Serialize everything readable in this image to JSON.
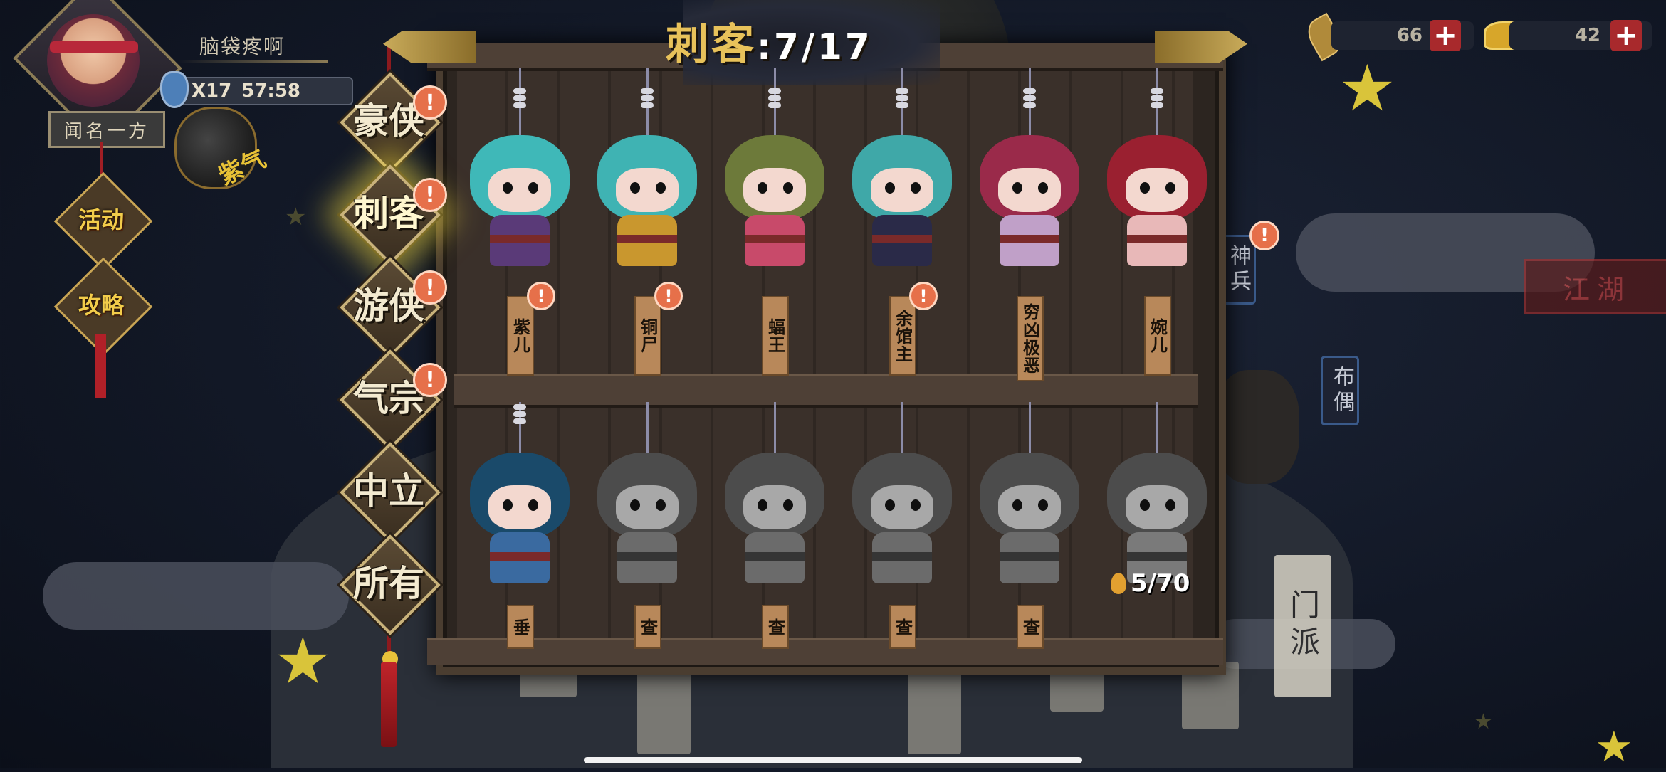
{
  "player": {
    "name": "脑袋疼啊",
    "multiplier": "X17",
    "timer": "57:58",
    "title": "闻名一方",
    "pouch_label": "紫气"
  },
  "side_menu": [
    {
      "label": "活动"
    },
    {
      "label": "攻略"
    }
  ],
  "currency": {
    "leaf_value": "66",
    "ingot_value": "42",
    "plus_label": "+"
  },
  "banner": {
    "title": "刺客",
    "separator": ":",
    "count": "7/17"
  },
  "categories": [
    {
      "label": "豪侠",
      "alert": "!",
      "active": false
    },
    {
      "label": "刺客",
      "alert": "!",
      "active": true
    },
    {
      "label": "游侠",
      "alert": "!",
      "active": false
    },
    {
      "label": "气宗",
      "alert": "!",
      "active": false
    },
    {
      "label": "中立",
      "alert": "",
      "active": false
    },
    {
      "label": "所有",
      "alert": "",
      "active": false
    }
  ],
  "shelf_top": [
    {
      "name": "紫儿",
      "alert": "!",
      "unlocked": true,
      "head": "#3fb8b8",
      "body": "#5a3a78"
    },
    {
      "name": "铜尸",
      "alert": "!",
      "unlocked": true,
      "head": "#3fb3b3",
      "body": "#c9972e"
    },
    {
      "name": "蝠王",
      "alert": "",
      "unlocked": true,
      "head": "#6d7a3a",
      "body": "#c84a6a"
    },
    {
      "name": "余馆主",
      "alert": "!",
      "unlocked": true,
      "head": "#3fa8a8",
      "body": "#2a2a48"
    },
    {
      "name": "穷凶极恶",
      "alert": "",
      "unlocked": true,
      "head": "#9a2a4a",
      "body": "#c0a0c8"
    },
    {
      "name": "婉儿",
      "alert": "",
      "unlocked": true,
      "head": "#9a2030",
      "body": "#e8b8b8"
    }
  ],
  "shelf_bottom": [
    {
      "name": "垂",
      "unlocked": true,
      "head": "#1a4a6a",
      "body": "#3a6aa0"
    },
    {
      "name": "查",
      "unlocked": false,
      "head": "#555",
      "body": "#777"
    },
    {
      "name": "查",
      "unlocked": false,
      "head": "#555",
      "body": "#777"
    },
    {
      "name": "查",
      "unlocked": false,
      "head": "#555",
      "body": "#777"
    },
    {
      "name": "查",
      "unlocked": false,
      "head": "#555",
      "body": "#777"
    },
    {
      "name": "",
      "unlocked": false,
      "head": "#555",
      "body": "#888"
    }
  ],
  "unlock_cost": "5/70",
  "right_tags": {
    "shenbing": "神兵",
    "buou": "布偶",
    "jianghu": "江湖",
    "menpai": "门派",
    "alert": "!"
  },
  "colors": {
    "accent_gold": "#e8c25a",
    "alert_orange": "#e6704a",
    "frame_brown": "#4a3d30"
  }
}
